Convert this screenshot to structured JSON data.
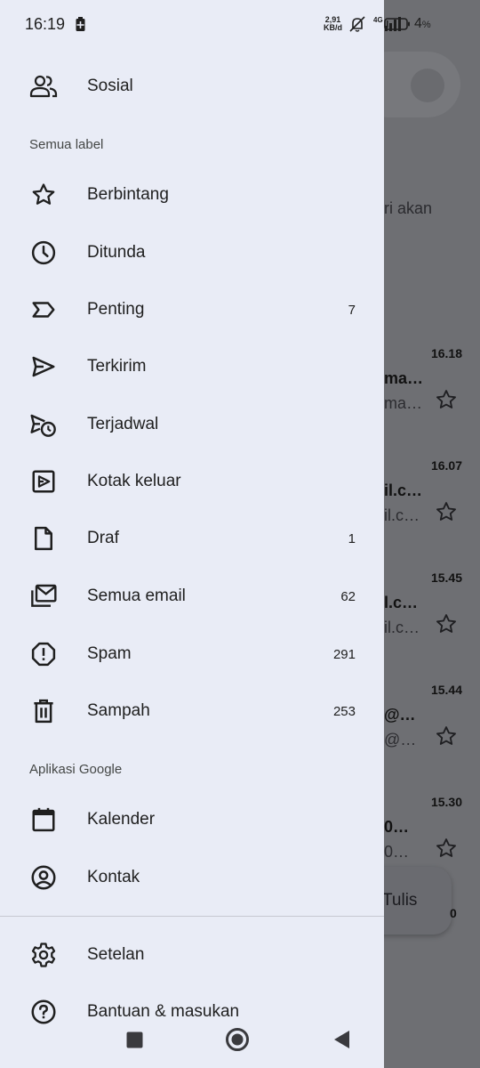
{
  "status_bar": {
    "time": "16:19",
    "net_speed_value": "2,91",
    "net_speed_unit": "KB/d",
    "network_type": "4G",
    "battery_percent": "4",
    "battery_percent_suffix": "%"
  },
  "drawer": {
    "top_item": {
      "label": "Sosial",
      "icon": "people-icon"
    },
    "section_all_labels": "Semua label",
    "labels": [
      {
        "label": "Berbintang",
        "icon": "star-icon",
        "count": ""
      },
      {
        "label": "Ditunda",
        "icon": "clock-icon",
        "count": ""
      },
      {
        "label": "Penting",
        "icon": "important-icon",
        "count": "7"
      },
      {
        "label": "Terkirim",
        "icon": "send-icon",
        "count": ""
      },
      {
        "label": "Terjadwal",
        "icon": "scheduled-send-icon",
        "count": ""
      },
      {
        "label": "Kotak keluar",
        "icon": "outbox-icon",
        "count": ""
      },
      {
        "label": "Draf",
        "icon": "draft-icon",
        "count": "1"
      },
      {
        "label": "Semua email",
        "icon": "all-mail-icon",
        "count": "62"
      },
      {
        "label": "Spam",
        "icon": "spam-icon",
        "count": "291"
      },
      {
        "label": "Sampah",
        "icon": "trash-icon",
        "count": "253"
      }
    ],
    "section_google_apps": "Aplikasi Google",
    "apps": [
      {
        "label": "Kalender",
        "icon": "calendar-icon"
      },
      {
        "label": "Kontak",
        "icon": "contact-icon"
      }
    ],
    "footer": [
      {
        "label": "Setelan",
        "icon": "gear-icon"
      },
      {
        "label": "Bantuan & masukan",
        "icon": "help-icon"
      }
    ]
  },
  "background": {
    "partial_text": "ri akan",
    "emails": [
      {
        "time": "16.18",
        "from": "ma…",
        "snippet": "ma…"
      },
      {
        "time": "16.07",
        "from": "il.c…",
        "snippet": "il.c…"
      },
      {
        "time": "15.45",
        "from": "l.c…",
        "snippet": "il.c…"
      },
      {
        "time": "15.44",
        "from": "@…",
        "snippet": "@…"
      },
      {
        "time": "15.30",
        "from": "0…",
        "snippet": "0…"
      }
    ],
    "compose_label": "Tulis",
    "partial_count": "0"
  },
  "colors": {
    "drawer_bg": "#e9ecf6",
    "scrim": "#6e6f73",
    "text_primary": "#1f1f1f",
    "text_secondary": "#444746"
  }
}
